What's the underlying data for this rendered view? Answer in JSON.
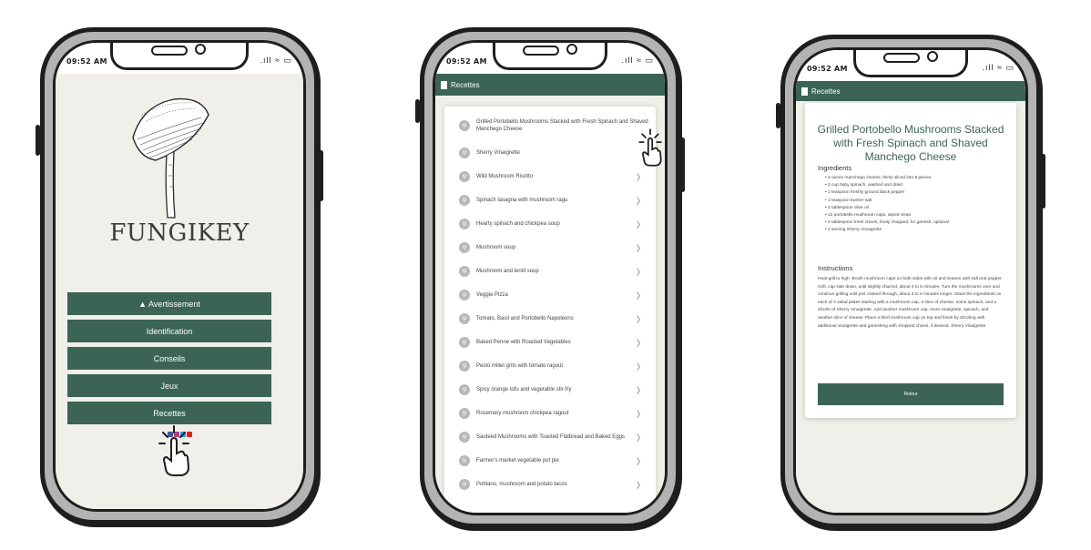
{
  "status": {
    "time": "09:52 AM",
    "icons": ".ıll ≈ ▭"
  },
  "screen1": {
    "brand": "FUNGIKEY",
    "menu": [
      {
        "label": "▲ Avertissement"
      },
      {
        "label": "Identification"
      },
      {
        "label": "Conseils"
      },
      {
        "label": "Jeux"
      },
      {
        "label": "Recettes"
      }
    ],
    "social_icons": [
      "facebook-icon",
      "instagram-icon",
      "twitter-icon",
      "youtube-icon"
    ]
  },
  "screen2": {
    "appbar_title": "Recettes",
    "items": [
      "Grilled Portobello Mushrooms Stacked with Fresh Spinach and Shaved Manchego Cheese",
      "Sherry Vinaigrette",
      "Wild Mushroom Risotto",
      "Spinach lasagna with mushroom ragu",
      "Hearty spinach and chickpea soup",
      "Mushroom soup",
      "Mushroom and lentil soup",
      "Veggie Pizza",
      "Tomato, Basil and Portobello Napoleons",
      "Baked Penne with Roasted Vegetables",
      "Pesto millet grits with tomato ragout",
      "Spicy orange tofu and vegetable stir-fry",
      "Rosemary mushroom chickpea ragout",
      "Sauteed Mushrooms with Toasted Flatbread and Baked Eggs",
      "Farmer's market vegetable pot pie",
      "Poblano, mushroom and potato tacos"
    ]
  },
  "screen3": {
    "appbar_title": "Recettes",
    "recipe_title": "Grilled Portobello Mushrooms Stacked with Fresh Spinach and Shaved Manchego Cheese",
    "ingredients_heading": "Ingredients",
    "ingredients": [
      "4 ounce manchego cheese, thinly sliced into 8 pieces",
      "3 cup baby spinach, washed and dried",
      "1 teaspoon freshly ground black pepper",
      "1 teaspoon kosher salt",
      "2 tablespoon olive oil",
      "12 portobello mushroom caps, wiped clean",
      "2 tablespoon fresh chives, finely chopped, for garnish, optional",
      "1 serving Sherry Vinaigrette"
    ],
    "instructions_heading": "Instructions",
    "instructions": "Heat grill to high. Brush mushroom caps on both sides with oil and season with salt and pepper. Grill, cap side down, until slightly charred, about 4 to 5 minutes. Turn the mushrooms over and continue grilling until just cooked through, about 3 to 4 minutes longer. Stack the ingredients on each of 4 salad plates starting with a mushroom cap, a slice of cheese, some spinach, and a drizzle of Sherry Vinaigrette. Add another mushroom cap, more vinaigrette, spinach, and another slice of cheese. Place a third mushroom cap on top and finish by drizzling with additional vinaigrette and garnishing with chopped chives, if desired. Sherry Vinaigrette",
    "back_label": "Retour"
  },
  "colors": {
    "accent": "#3b6457",
    "screen_bg": "#f0efe9",
    "frame": "#b3b3b3"
  }
}
